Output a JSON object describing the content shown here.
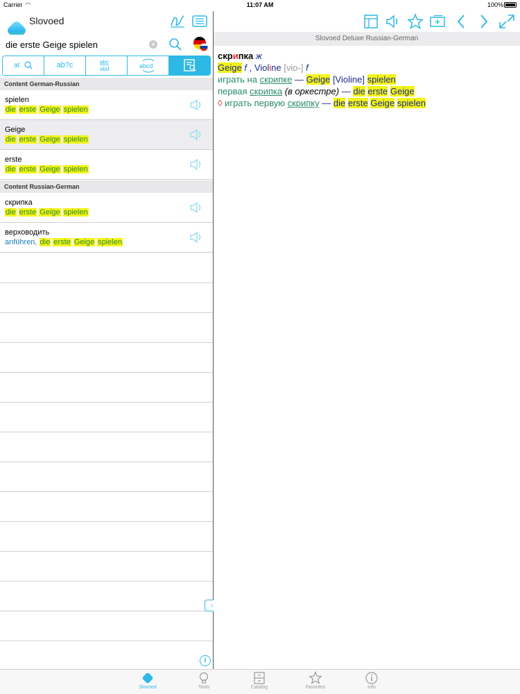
{
  "statusbar": {
    "carrier": "Carrier",
    "time": "11:07 AM",
    "battery": "100%"
  },
  "app": {
    "title": "Slovoed"
  },
  "search": {
    "value": "die erste Geige spielen",
    "placeholder": ""
  },
  "modes": [
    {
      "label": "at"
    },
    {
      "label": "ab?c"
    },
    {
      "label": "abc abd"
    },
    {
      "label": "abcd"
    },
    {
      "label": ""
    }
  ],
  "results": {
    "section1": "Content German-Russian",
    "section2": "Content Russian-German",
    "rows": [
      {
        "head": "spielen",
        "trans_prefix": "",
        "trans": [
          "die",
          "erste",
          "Geige",
          "spielen"
        ]
      },
      {
        "head": "Geige",
        "trans_prefix": "",
        "trans": [
          "die",
          "erste",
          "Geige",
          "spielen"
        ]
      },
      {
        "head": "erste",
        "trans_prefix": "",
        "trans": [
          "die",
          "erste",
          "Geige",
          "spielen"
        ]
      },
      {
        "head": "скрипка",
        "trans_prefix": "",
        "trans": [
          "die",
          "erste",
          "Geige",
          "spielen"
        ]
      },
      {
        "head": "верховодить",
        "trans_prefix": "anführen,",
        "trans": [
          "die",
          "erste",
          "Geige",
          "spielen"
        ]
      }
    ]
  },
  "right": {
    "subheader": "Slovoed Deluxe Russian-German",
    "article": {
      "headword_pre": "скр",
      "headword_stress": "и",
      "headword_post": "пка",
      "gender": "ж",
      "l2": {
        "w1": "Geige",
        "g1": "f",
        "sep": ",",
        "w2a": "Viol",
        "w2stress": "i",
        "w2b": "ne",
        "phon": "[vio-]",
        "g2": "f"
      },
      "l3": {
        "ru1": "играть на",
        "link": "скрипке",
        "dash": "—",
        "de1": "Geige",
        "note": "[Violine]",
        "de2": "spielen"
      },
      "l4": {
        "ru1": "первая",
        "link": "скрипка",
        "paren": "(в оркестре)",
        "dash": "—",
        "de": [
          "die",
          "erste",
          "Geige"
        ]
      },
      "l5": {
        "mark": "◊",
        "ru1": "играть первую",
        "link": "скрипку",
        "dash": "—",
        "de": [
          "die",
          "erste",
          "Geige",
          "spielen"
        ]
      }
    }
  },
  "tabs": [
    {
      "label": "Slovoed",
      "icon": "slovoed-logo-icon",
      "active": true
    },
    {
      "label": "Tools",
      "icon": "lightbulb-icon",
      "active": false
    },
    {
      "label": "Catalog",
      "icon": "cabinet-icon",
      "active": false
    },
    {
      "label": "Favorites",
      "icon": "star-icon",
      "active": false
    },
    {
      "label": "Info",
      "icon": "info-icon",
      "active": false
    }
  ],
  "colors": {
    "accent": "#2eb8e6",
    "highlight": "#f3f31a",
    "green_text": "#2a8a2a",
    "link_blue": "#1a7bb8"
  }
}
